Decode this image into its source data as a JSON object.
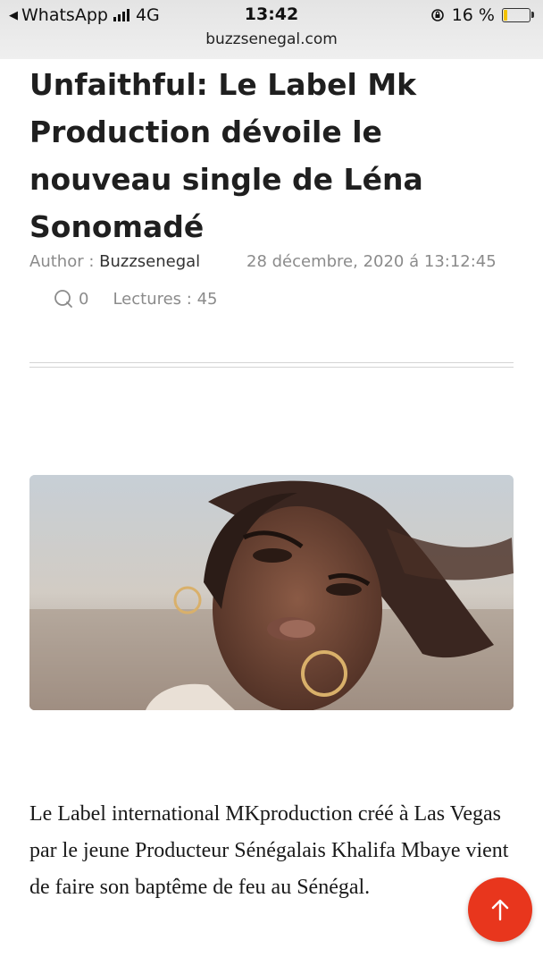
{
  "status_bar": {
    "back_app": "WhatsApp",
    "network": "4G",
    "time": "13:42",
    "battery": "16 %",
    "battery_level": 0.16,
    "url": "buzzsenegal.com"
  },
  "article": {
    "title": "Unfaithful: Le Label Mk Production dévoile le nouveau single de Léna Sonomadé",
    "author_label": "Author :",
    "author_name": "Buzzsenegal",
    "date": "28 décembre, 2020 á 13:12:45",
    "comments_count": "0",
    "reads": "Lectures : 45",
    "body": "Le Label international MKproduction créé à Las Vegas par le jeune Producteur Sénégalais Khalifa Mbaye vient de faire son baptême de feu au Sénégal."
  },
  "colors": {
    "fab": "#e8361d",
    "meta_text": "#8b8b8b",
    "battery_fill": "#f2c200"
  },
  "icons": {
    "comment": "comment-icon",
    "scroll_top": "arrow-up-icon",
    "back": "back-triangle-icon"
  }
}
